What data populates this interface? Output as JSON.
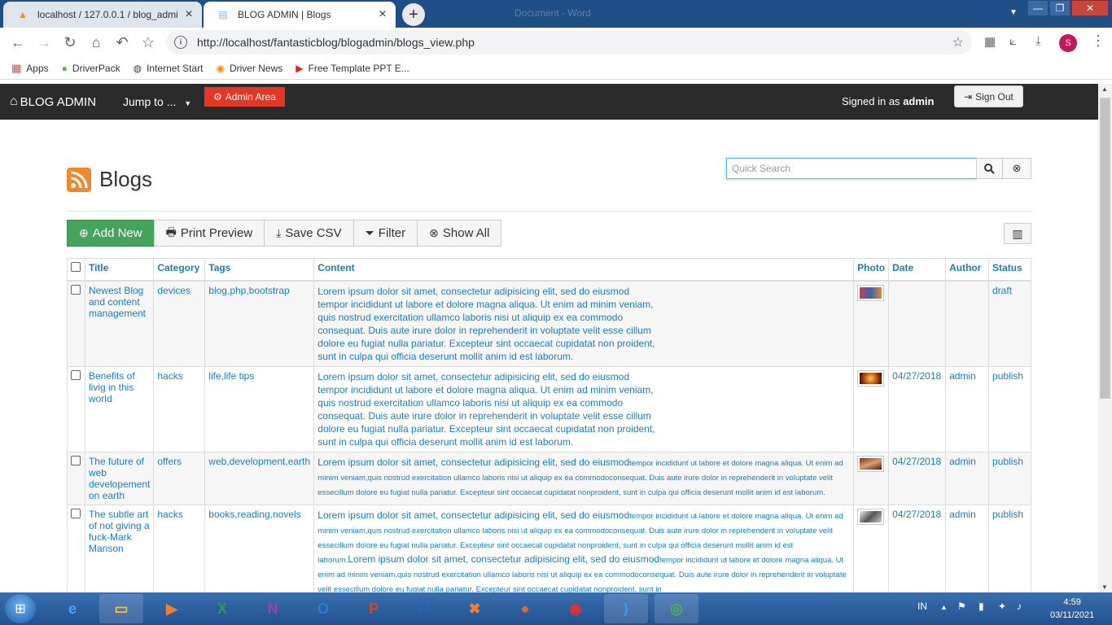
{
  "browser": {
    "tabs": [
      {
        "title": "localhost / 127.0.0.1 / blog_admi",
        "active": false
      },
      {
        "title": "BLOG ADMIN | Blogs",
        "active": true
      }
    ],
    "window_title": "Document - Word",
    "url": "http://localhost/fantasticblog/blogadmin/blogs_view.php",
    "profile_initial": "S",
    "bookmarks": [
      "Apps",
      "DriverPack",
      "Internet Start",
      "Driver News",
      "Free Template PPT E..."
    ]
  },
  "navbar": {
    "brand": "BLOG ADMIN",
    "jump_label": "Jump to ...",
    "admin_area_label": "Admin Area",
    "signed_prefix": "Signed in as",
    "signed_user": "admin",
    "signout_label": "Sign Out"
  },
  "page": {
    "title": "Blogs",
    "search_placeholder": "Quick Search"
  },
  "buttons": {
    "add_new": "Add New",
    "print_preview": "Print Preview",
    "save_csv": "Save CSV",
    "filter": "Filter",
    "show_all": "Show All"
  },
  "table": {
    "headers": [
      "Title",
      "Category",
      "Tags",
      "Content",
      "Photo",
      "Date",
      "Author",
      "Status"
    ],
    "rows": [
      {
        "title": "Newest Blog and content management",
        "category": "devices",
        "tags": "blog,php,bootstrap",
        "content": "Lorem ipsum dolor sit amet, consectetur adipisicing elit, sed do eiusmod tempor incididunt ut labore et dolore magna aliqua. Ut enim ad minim veniam, quis nostrud exercitation ullamco laboris nisi ut aliquip ex ea commodo consequat. Duis aute irure dolor in reprehenderit in voluptate velit esse cillum dolore eu fugiat nulla pariatur. Excepteur sint occaecat cupidatat non proident, sunt in culpa qui officia deserunt mollit anim id est laborum.",
        "content_small": "",
        "date": "",
        "author": "",
        "status": "draft"
      },
      {
        "title": "Benefits of livig in this world",
        "category": "hacks",
        "tags": "life,life tips",
        "content": "Lorem ipsum dolor sit amet, consectetur adipisicing elit, sed do eiusmod tempor incididunt ut labore et dolore magna aliqua. Ut enim ad minim veniam, quis nostrud exercitation ullamco laboris nisi ut aliquip ex ea commodo consequat. Duis aute irure dolor in reprehenderit in voluptate velit esse cillum dolore eu fugiat nulla pariatur. Excepteur sint occaecat cupidatat non proident, sunt in culpa qui officia deserunt mollit anim id est laborum.",
        "content_small": "",
        "date": "04/27/2018",
        "author": "admin",
        "status": "publish"
      },
      {
        "title": "The future of web developement on earth",
        "category": "offers",
        "tags": "web,development,earth",
        "content": "Lorem ipsum dolor sit amet, consectetur adipisicing elit, sed do eiusmod",
        "content_small": "tempor incididunt ut labore et dolore magna aliqua. Ut enim ad minim veniam,quis nostrud exercitation ullamco laboris nisi ut aliquip ex ea commodoconsequat. Duis aute irure dolor in reprehenderit in voluptate velit essecillum dolore eu fugiat nulla pariatur. Excepteur sint occaecat cupidatat nonproident, sunt in culpa qui officia deserunt mollit anim id est laborum.",
        "date": "04/27/2018",
        "author": "admin",
        "status": "publish"
      },
      {
        "title": "The subtle art of not giving a fuck-Mark Manson",
        "category": "hacks",
        "tags": "books,reading,novels",
        "content": "Lorem ipsum dolor sit amet, consectetur adipisicing elit, sed do eiusmod",
        "content_small": "tempor incididunt ut labore et dolore magna aliqua. Ut enim ad minim veniam,quis nostrud exercitation ullamco laboris nisi ut aliquip ex ea commodoconsequat. Duis aute irure dolor in reprehenderit in voluptate velit essecillum dolore eu fugiat nulla pariatur. Excepteur sint occaecat cupidatat nonproident, sunt in culpa qui officia deserunt mollit anim id est laborum.",
        "content2": "Lorem ipsum dolor sit amet, consectetur adipisicing elit, sed do eiusmod",
        "content2_small": "tempor incididunt ut labore et dolore magna aliqua. Ut enim ad minim veniam,quis nostrud exercitation ullamco laboris nisi ut aliquip ex ea commodoconsequat. Duis aute irure dolor in reprehenderit in voluptate velit essecillum dolore eu fugiat nulla pariatur. Excepteur sint occaecat cupidatat nonproident, sunt in",
        "date": "04/27/2018",
        "author": "admin",
        "status": "publish"
      }
    ]
  },
  "taskbar": {
    "language": "IN",
    "time": "4:59",
    "date": "03/11/2021"
  },
  "colors": {
    "navbar": "#2b2b2b",
    "admin_area": "#e43725",
    "add_new": "#45a35b",
    "link": "#1a7fbf"
  }
}
